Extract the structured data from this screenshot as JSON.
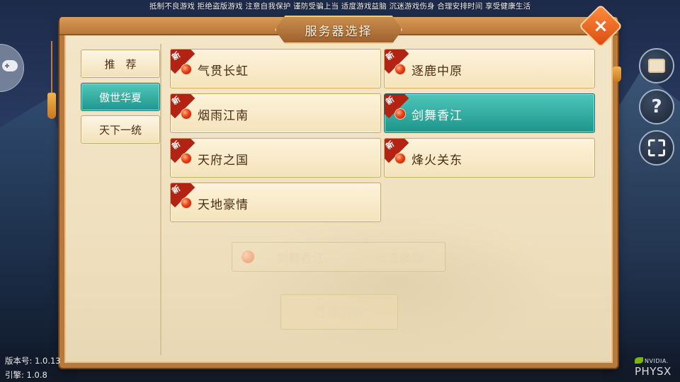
{
  "notice": "抵制不良游戏 拒绝盗版游戏 注意自我保护 谨防受骗上当 适度游戏益脑 沉迷游戏伤身 合理安排时间 享受健康生活",
  "dialog": {
    "title": "服务器选择",
    "close_label": "×"
  },
  "categories": [
    {
      "label": "推　荐",
      "active": false
    },
    {
      "label": "傲世华夏",
      "active": true
    },
    {
      "label": "天下一统",
      "active": false
    }
  ],
  "servers": [
    {
      "name": "气贯长虹",
      "badge": "新",
      "selected": false
    },
    {
      "name": "逐鹿中原",
      "badge": "新",
      "selected": false
    },
    {
      "name": "烟雨江南",
      "badge": "新",
      "selected": false
    },
    {
      "name": "剑舞香江",
      "badge": "新",
      "selected": true
    },
    {
      "name": "天府之国",
      "badge": "新",
      "selected": false
    },
    {
      "name": "烽火关东",
      "badge": "新",
      "selected": false
    },
    {
      "name": "天地豪情",
      "badge": "新",
      "selected": false
    }
  ],
  "login_area": {
    "current_server": "剑舞香江",
    "switch_label": "点击换服",
    "login_label": "登录游戏"
  },
  "side_icons": {
    "help_glyph": "?"
  },
  "footer": {
    "version": "版本号: 1.0.13",
    "engine": "引擎: 1.0.8",
    "nvidia": "NVIDIA.",
    "physx": "PHYSX"
  },
  "colors": {
    "active_teal": "#1f968c",
    "frame_brown": "#b77a3c",
    "badge_red": "#b22314"
  }
}
